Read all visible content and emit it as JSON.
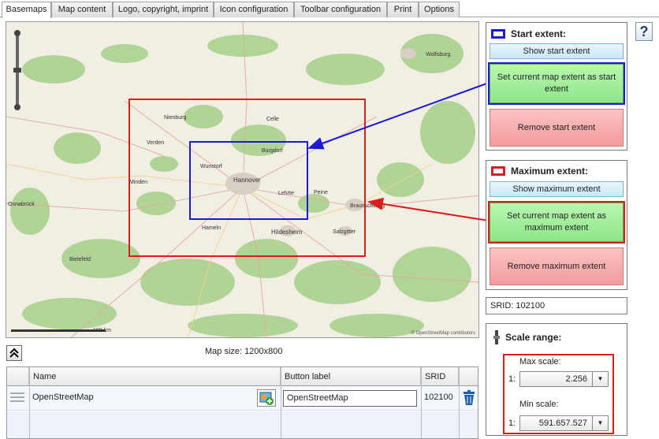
{
  "tabs": [
    {
      "label": "Basemaps",
      "active": true
    },
    {
      "label": "Map content",
      "active": false
    },
    {
      "label": "Logo, copyright, imprint",
      "active": false
    },
    {
      "label": "Icon configuration",
      "active": false
    },
    {
      "label": "Toolbar configuration",
      "active": false
    },
    {
      "label": "Print",
      "active": false
    },
    {
      "label": "Options",
      "active": false
    }
  ],
  "help_label": "?",
  "start_extent": {
    "title": "Start extent:",
    "show_label": "Show start extent",
    "set_label": "Set current map extent as start extent",
    "remove_label": "Remove start extent",
    "color": "#1a1ad6"
  },
  "max_extent": {
    "title": "Maximum extent:",
    "show_label": "Show maximum extent",
    "set_label": "Set current map extent as maximum extent",
    "remove_label": "Remove maximum extent",
    "color": "#d91c1c"
  },
  "srid_text": "SRID: 102100",
  "scale_range": {
    "title": "Scale range:",
    "max_label": "Max scale:",
    "max_prefix": "1:",
    "max_value": "2.256",
    "min_label": "Min scale:",
    "min_prefix": "1:",
    "min_value": "591.657.527"
  },
  "map": {
    "attribution": "© OpenStreetMap contributors",
    "scale_bar": "100 km",
    "labels": [
      {
        "text": "Hannover"
      },
      {
        "text": "Hildesheim"
      },
      {
        "text": "Salzgitter"
      },
      {
        "text": "Wolfsburg"
      },
      {
        "text": "Braunschweig"
      },
      {
        "text": "Bielefeld"
      },
      {
        "text": "Osnabrück"
      },
      {
        "text": "Celle"
      },
      {
        "text": "Nienburg"
      },
      {
        "text": "Wunstorf"
      },
      {
        "text": "Burgdorf"
      },
      {
        "text": "Peine"
      },
      {
        "text": "Minden"
      },
      {
        "text": "Hameln"
      },
      {
        "text": "Verden"
      },
      {
        "text": "Lehrte"
      }
    ]
  },
  "map_size_text": "Map size: 1200x800",
  "collapse_icon": "⏶",
  "grid": {
    "columns": [
      "Name",
      "Button label",
      "SRID"
    ],
    "rows": [
      {
        "name": "OpenStreetMap",
        "button_label": "OpenStreetMap",
        "srid": "102100"
      }
    ]
  }
}
